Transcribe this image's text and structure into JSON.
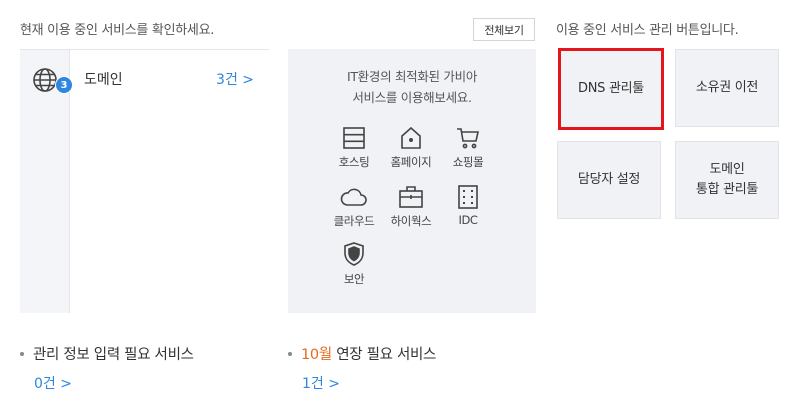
{
  "left": {
    "intro": "현재 이용 중인 서비스를 확인하세요.",
    "view_all": "전체보기",
    "service": {
      "icon": "globe-icon",
      "badge": "3",
      "label": "도메인",
      "count": "3건 >"
    }
  },
  "recommend": {
    "line1": "IT환경의 최적화된 가비아",
    "line2": "서비스를 이용해보세요.",
    "items": [
      {
        "icon": "server-icon",
        "label": "호스팅"
      },
      {
        "icon": "home-icon",
        "label": "홈페이지"
      },
      {
        "icon": "cart-icon",
        "label": "쇼핑몰"
      },
      {
        "icon": "cloud-icon",
        "label": "클라우드"
      },
      {
        "icon": "briefcase-icon",
        "label": "하이웍스"
      },
      {
        "icon": "idc-building-icon",
        "label": "IDC"
      },
      {
        "icon": "shield-icon",
        "label": "보안"
      }
    ]
  },
  "manage": {
    "title": "이용 중인 서비스 관리 버튼입니다.",
    "buttons": {
      "dns": "DNS 관리툴",
      "ownership": "소유권 이전",
      "contact": "담당자 설정",
      "domain_line1": "도메인",
      "domain_line2": "통합 관리툴"
    },
    "highlight_color": "#e3161e"
  },
  "bottom": {
    "info_label": "관리 정보 입력 필요 서비스",
    "info_count": "0건 >",
    "renew_month": "10월",
    "renew_label": " 연장 필요 서비스",
    "renew_count": "1건 >"
  },
  "colors": {
    "accent": "#2e86de",
    "panel_bg": "#f1f2f6",
    "orange": "#e46b1f"
  }
}
